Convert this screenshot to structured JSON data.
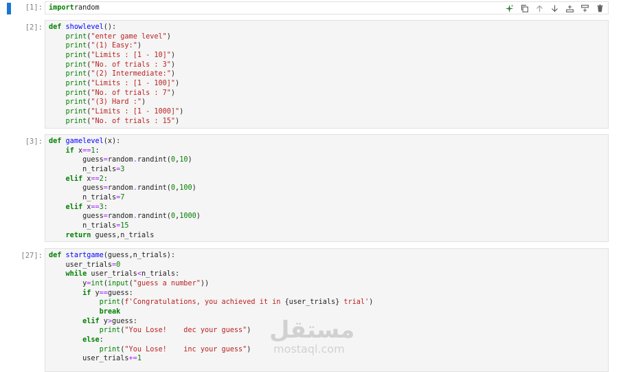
{
  "cells": [
    {
      "prompt": "[1]:",
      "active": true,
      "lines": [
        [
          [
            "kw",
            "import"
          ],
          [
            "",
            "random"
          ]
        ]
      ]
    },
    {
      "prompt": "[2]:",
      "lines": [
        [
          [
            "kw",
            "def"
          ],
          [
            "",
            " "
          ],
          [
            "fn",
            "showlevel"
          ],
          [
            "",
            "():"
          ]
        ],
        [
          [
            "",
            "    "
          ],
          [
            "bi",
            "print"
          ],
          [
            "",
            "("
          ],
          [
            "st",
            "\"enter game level\""
          ],
          [
            "",
            ")"
          ]
        ],
        [
          [
            "",
            "    "
          ],
          [
            "bi",
            "print"
          ],
          [
            "",
            "("
          ],
          [
            "st",
            "\"(1) Easy:\""
          ],
          [
            "",
            ")"
          ]
        ],
        [
          [
            "",
            "    "
          ],
          [
            "bi",
            "print"
          ],
          [
            "",
            "("
          ],
          [
            "st",
            "\"Limits : [1 - 10]\""
          ],
          [
            "",
            ")"
          ]
        ],
        [
          [
            "",
            "    "
          ],
          [
            "bi",
            "print"
          ],
          [
            "",
            "("
          ],
          [
            "st",
            "\"No. of trials : 3\""
          ],
          [
            "",
            ")"
          ]
        ],
        [
          [
            "",
            "    "
          ],
          [
            "bi",
            "print"
          ],
          [
            "",
            "("
          ],
          [
            "st",
            "\"(2) Intermediate:\""
          ],
          [
            "",
            ")"
          ]
        ],
        [
          [
            "",
            "    "
          ],
          [
            "bi",
            "print"
          ],
          [
            "",
            "("
          ],
          [
            "st",
            "\"Limits : [1 - 100]\""
          ],
          [
            "",
            ")"
          ]
        ],
        [
          [
            "",
            "    "
          ],
          [
            "bi",
            "print"
          ],
          [
            "",
            "("
          ],
          [
            "st",
            "\"No. of trials : 7\""
          ],
          [
            "",
            ")"
          ]
        ],
        [
          [
            "",
            "    "
          ],
          [
            "bi",
            "print"
          ],
          [
            "",
            "("
          ],
          [
            "st",
            "\"(3) Hard :\""
          ],
          [
            "",
            ")"
          ]
        ],
        [
          [
            "",
            "    "
          ],
          [
            "bi",
            "print"
          ],
          [
            "",
            "("
          ],
          [
            "st",
            "\"Limits : [1 - 1000]\""
          ],
          [
            "",
            ")"
          ]
        ],
        [
          [
            "",
            "    "
          ],
          [
            "bi",
            "print"
          ],
          [
            "",
            "("
          ],
          [
            "st",
            "\"No. of trials : 15\""
          ],
          [
            "",
            ")"
          ]
        ]
      ]
    },
    {
      "prompt": "[3]:",
      "lines": [
        [
          [
            "kw",
            "def"
          ],
          [
            "",
            " "
          ],
          [
            "fn",
            "gamelevel"
          ],
          [
            "",
            "(x):"
          ]
        ],
        [
          [
            "",
            "    "
          ],
          [
            "kw",
            "if"
          ],
          [
            "",
            " x"
          ],
          [
            "op",
            "=="
          ],
          [
            "nm",
            "1"
          ],
          [
            "",
            ":"
          ]
        ],
        [
          [
            "",
            "        guess"
          ],
          [
            "op",
            "="
          ],
          [
            "",
            "random"
          ],
          [
            "op",
            "."
          ],
          [
            "",
            "randint("
          ],
          [
            "nm",
            "0"
          ],
          [
            "",
            ","
          ],
          [
            "nm",
            "10"
          ],
          [
            "",
            ")"
          ]
        ],
        [
          [
            "",
            "        n_trials"
          ],
          [
            "op",
            "="
          ],
          [
            "nm",
            "3"
          ]
        ],
        [
          [
            "",
            "    "
          ],
          [
            "kw",
            "elif"
          ],
          [
            "",
            " x"
          ],
          [
            "op",
            "=="
          ],
          [
            "nm",
            "2"
          ],
          [
            "",
            ":"
          ]
        ],
        [
          [
            "",
            "        guess"
          ],
          [
            "op",
            "="
          ],
          [
            "",
            "random"
          ],
          [
            "op",
            "."
          ],
          [
            "",
            "randint("
          ],
          [
            "nm",
            "0"
          ],
          [
            "",
            ","
          ],
          [
            "nm",
            "100"
          ],
          [
            "",
            ")"
          ]
        ],
        [
          [
            "",
            "        n_trials"
          ],
          [
            "op",
            "="
          ],
          [
            "nm",
            "7"
          ]
        ],
        [
          [
            "",
            "    "
          ],
          [
            "kw",
            "elif"
          ],
          [
            "",
            " x"
          ],
          [
            "op",
            "=="
          ],
          [
            "nm",
            "3"
          ],
          [
            "",
            ":"
          ]
        ],
        [
          [
            "",
            "        guess"
          ],
          [
            "op",
            "="
          ],
          [
            "",
            "random"
          ],
          [
            "op",
            "."
          ],
          [
            "",
            "randint("
          ],
          [
            "nm",
            "0"
          ],
          [
            "",
            ","
          ],
          [
            "nm",
            "1000"
          ],
          [
            "",
            ")"
          ]
        ],
        [
          [
            "",
            "        n_trials"
          ],
          [
            "op",
            "="
          ],
          [
            "nm",
            "15"
          ]
        ],
        [
          [
            "",
            "    "
          ],
          [
            "kw",
            "return"
          ],
          [
            "",
            " guess,n_trials"
          ]
        ]
      ]
    },
    {
      "prompt": "[27]:",
      "lines": [
        [
          [
            "kw",
            "def"
          ],
          [
            "",
            " "
          ],
          [
            "fn",
            "startgame"
          ],
          [
            "",
            "(guess,n_trials):"
          ]
        ],
        [
          [
            "",
            "    user_trials"
          ],
          [
            "op",
            "="
          ],
          [
            "nm",
            "0"
          ]
        ],
        [
          [
            "",
            "    "
          ],
          [
            "kw",
            "while"
          ],
          [
            "",
            " user_trials"
          ],
          [
            "op",
            "<"
          ],
          [
            "",
            "n_trials:"
          ]
        ],
        [
          [
            "",
            "        y"
          ],
          [
            "op",
            "="
          ],
          [
            "bi",
            "int"
          ],
          [
            "",
            "("
          ],
          [
            "bi",
            "input"
          ],
          [
            "",
            "("
          ],
          [
            "st",
            "\"guess a number\""
          ],
          [
            "",
            "))"
          ]
        ],
        [
          [
            "",
            "        "
          ],
          [
            "kw",
            "if"
          ],
          [
            "",
            " y"
          ],
          [
            "op",
            "=="
          ],
          [
            "",
            "guess:"
          ]
        ],
        [
          [
            "",
            "            "
          ],
          [
            "bi",
            "print"
          ],
          [
            "",
            "("
          ],
          [
            "st",
            "f'Congratulations, you achieved it in "
          ],
          [
            "",
            "{user_trials}"
          ],
          [
            "st",
            " trial'"
          ],
          [
            "",
            ")"
          ]
        ],
        [
          [
            "",
            "            "
          ],
          [
            "kw",
            "break"
          ]
        ],
        [
          [
            "",
            "        "
          ],
          [
            "kw",
            "elif"
          ],
          [
            "",
            " y"
          ],
          [
            "op",
            ">"
          ],
          [
            "",
            "guess:"
          ]
        ],
        [
          [
            "",
            "            "
          ],
          [
            "bi",
            "print"
          ],
          [
            "",
            "("
          ],
          [
            "st",
            "\"You Lose!    dec your guess\""
          ],
          [
            "",
            ")"
          ]
        ],
        [
          [
            "",
            "        "
          ],
          [
            "kw",
            "else"
          ],
          [
            "",
            ":"
          ]
        ],
        [
          [
            "",
            "            "
          ],
          [
            "bi",
            "print"
          ],
          [
            "",
            "("
          ],
          [
            "st",
            "\"You Lose!    inc your guess\""
          ],
          [
            "",
            ")"
          ]
        ],
        [
          [
            "",
            "        user_trials"
          ],
          [
            "op",
            "+="
          ],
          [
            "nm",
            "1"
          ]
        ]
      ]
    }
  ],
  "toolbar": {
    "items": [
      "sparkle-icon",
      "duplicate-icon",
      "move-up-icon",
      "move-down-icon",
      "insert-above-icon",
      "insert-below-icon",
      "delete-icon"
    ]
  },
  "colors": {
    "keyword": "#008000",
    "function": "#0000ff",
    "string": "#ba2121",
    "number": "#008000",
    "operator": "#aa22ff",
    "active_bar": "#1976d2",
    "cell_bg": "#f5f5f5"
  },
  "watermark": {
    "arabic": "مستقل",
    "latin": "mostaql.com"
  }
}
